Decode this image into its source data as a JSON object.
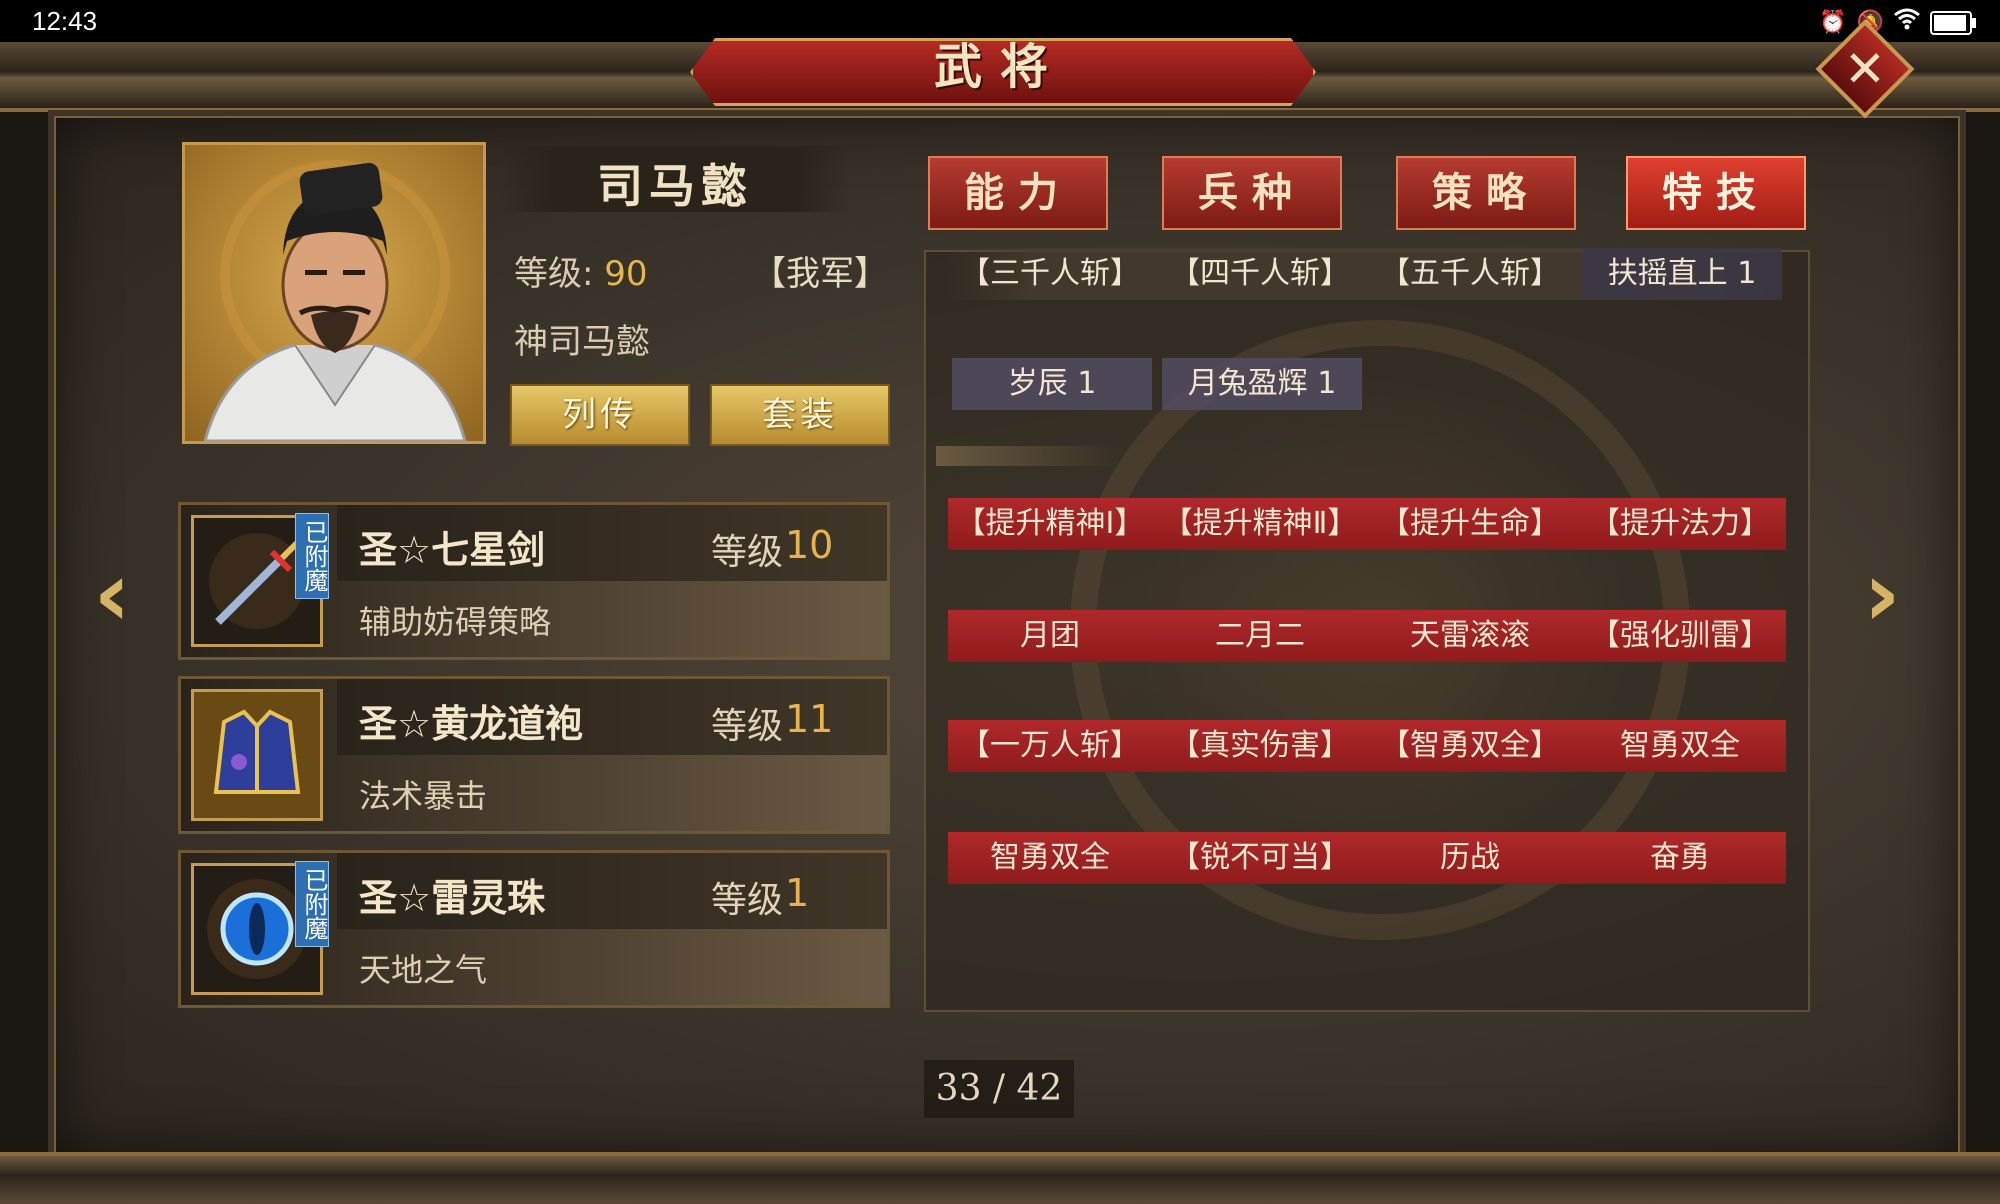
{
  "status_bar": {
    "time": "12:43"
  },
  "window": {
    "title": "武将",
    "close_label": "✕"
  },
  "hero": {
    "name": "司马懿",
    "level_label": "等级:",
    "level_value": "90",
    "faction": "【我军】",
    "title": "神司马懿",
    "buttons": {
      "biography": "列传",
      "set": "套装"
    }
  },
  "equipment": [
    {
      "name": "圣☆七星剑",
      "level_label": "等级",
      "level": "10",
      "desc": "辅助妨碍策略",
      "enchant": "已附魔",
      "icon": "sword-icon"
    },
    {
      "name": "圣☆黄龙道袍",
      "level_label": "等级",
      "level": "11",
      "desc": "法术暴击",
      "enchant": "",
      "icon": "robe-icon"
    },
    {
      "name": "圣☆雷灵珠",
      "level_label": "等级",
      "level": "1",
      "desc": "天地之气",
      "enchant": "已附魔",
      "icon": "orb-icon"
    }
  ],
  "tabs": [
    "能力",
    "兵种",
    "策略",
    "特技"
  ],
  "active_tab": "特技",
  "skills": {
    "row1": [
      "【三千人斩】",
      "【四千人斩】",
      "【五千人斩】",
      "扶摇直上 1"
    ],
    "row2": [
      "岁辰 1",
      "月兔盈辉 1"
    ],
    "row3": [
      "【提升精神Ⅰ】",
      "【提升精神Ⅱ】",
      "【提升生命】",
      "【提升法力】"
    ],
    "row4": [
      "月团",
      "二月二",
      "天雷滚滚",
      "【强化驯雷】"
    ],
    "row5": [
      "【一万人斩】",
      "【真实伤害】",
      "【智勇双全】",
      "智勇双全"
    ],
    "row6": [
      "智勇双全",
      "【锐不可当】",
      "历战",
      "奋勇"
    ]
  },
  "pagination": {
    "current": "33",
    "total": "42",
    "text": "33 / 42"
  },
  "nav": {
    "prev": "‹",
    "next": "›"
  },
  "colors": {
    "accent_gold": "#e6b54c",
    "tab_red": "#b53b2e",
    "skill_red": "#b0282a"
  }
}
